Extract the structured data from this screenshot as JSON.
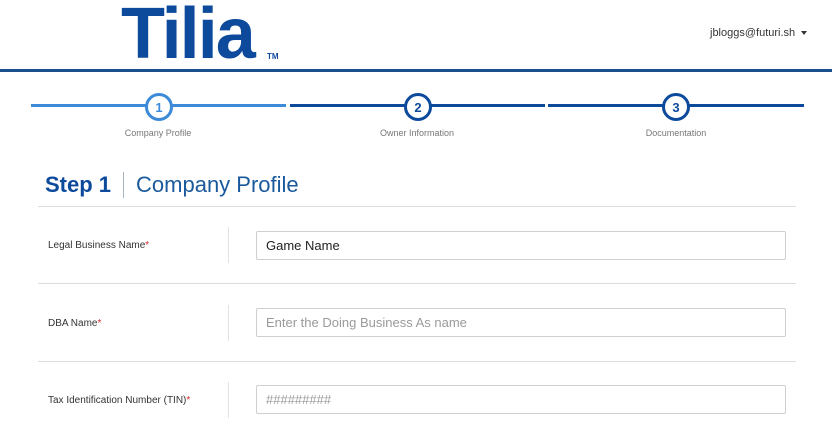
{
  "header": {
    "logo_text": "Tilia",
    "logo_tm": "TM",
    "user_email": "jbloggs@futuri.sh"
  },
  "stepper": {
    "steps": [
      {
        "number": "1",
        "label": "Company Profile",
        "active": true
      },
      {
        "number": "2",
        "label": "Owner Information",
        "active": false
      },
      {
        "number": "3",
        "label": "Documentation",
        "active": false
      }
    ]
  },
  "page": {
    "step_number": "Step 1",
    "step_title": "Company Profile"
  },
  "form": {
    "fields": [
      {
        "label": "Legal Business Name",
        "required_mark": "*",
        "value": "Game Name",
        "placeholder": ""
      },
      {
        "label": "DBA Name",
        "required_mark": "*",
        "value": "",
        "placeholder": "Enter the Doing Business As name"
      },
      {
        "label": "Tax Identification Number (TIN)",
        "required_mark": "*",
        "value": "",
        "placeholder": "#########"
      }
    ]
  },
  "colors": {
    "brand_blue": "#0d4a9c",
    "active_blue": "#3c8ad8",
    "required_red": "#d62b2b"
  }
}
